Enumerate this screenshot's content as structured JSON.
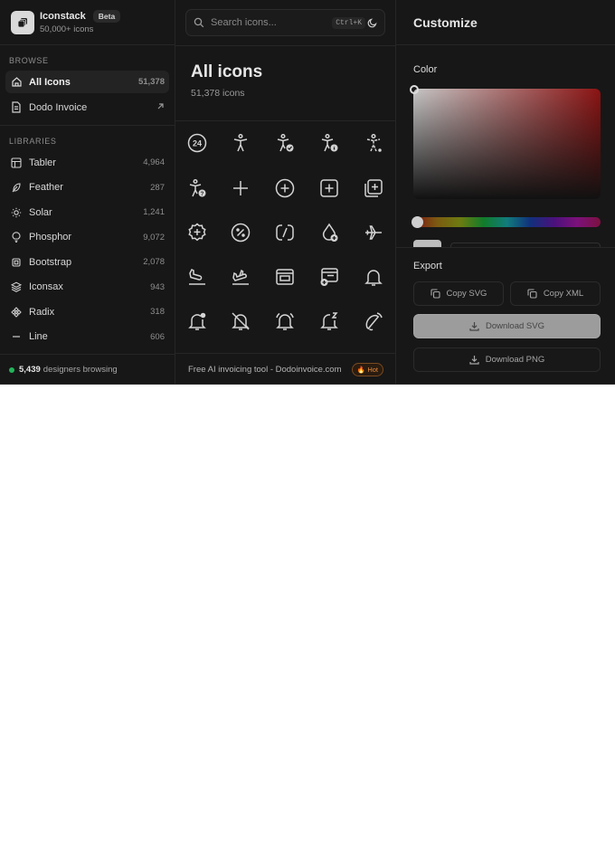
{
  "brand": {
    "name": "Iconstack",
    "badge": "Beta",
    "subtitle": "50,000+ icons"
  },
  "browse": {
    "label": "BROWSE",
    "items": [
      {
        "label": "All Icons",
        "count": "51,378",
        "icon": "home-icon",
        "active": true
      },
      {
        "label": "Dodo Invoice",
        "icon": "file-icon",
        "external": "arrow-up-right-icon"
      }
    ]
  },
  "libraries": {
    "label": "LIBRARIES",
    "items": [
      {
        "label": "Tabler",
        "count": "4,964",
        "icon": "table-icon"
      },
      {
        "label": "Feather",
        "count": "287",
        "icon": "feather-icon"
      },
      {
        "label": "Solar",
        "count": "1,241",
        "icon": "sun-icon"
      },
      {
        "label": "Phosphor",
        "count": "9,072",
        "icon": "lightbulb-icon"
      },
      {
        "label": "Bootstrap",
        "count": "2,078",
        "icon": "chip-icon"
      },
      {
        "label": "Iconsax",
        "count": "943",
        "icon": "layers-icon"
      },
      {
        "label": "Radix",
        "count": "318",
        "icon": "radix-icon"
      },
      {
        "label": "Line",
        "count": "606",
        "icon": "minus-icon"
      }
    ]
  },
  "browsing": {
    "count": "5,439",
    "text": "designers browsing"
  },
  "search": {
    "placeholder": "Search icons...",
    "shortcut": "Ctrl+K"
  },
  "main": {
    "title": "All icons",
    "count": "51,378 icons"
  },
  "icons": [
    "clock-24-icon",
    "accessible-icon",
    "accessible-check-icon",
    "accessible-info-icon",
    "accessible-off-icon",
    "accessible-question-icon",
    "plus-icon",
    "circle-plus-icon",
    "square-plus-icon",
    "squares-plus-icon",
    "badge-plus-icon",
    "badge-percent-icon",
    "ad-circle-icon",
    "droplet-plus-icon",
    "plane-icon",
    "plane-arrival-icon",
    "plane-departure-icon",
    "window-icon",
    "window-plus-icon",
    "bell-icon",
    "bell-ringing-icon",
    "bell-off-icon",
    "alarm-bell-icon",
    "bell-z-icon",
    "bell-ring-2-icon"
  ],
  "promo": {
    "text": "Free AI invoicing tool - Dodoinvoice.com",
    "badge": "Hot"
  },
  "customize": {
    "title": "Customize",
    "color_label": "Color",
    "export_label": "Export",
    "copy_svg": "Copy SVG",
    "copy_xml": "Copy XML",
    "download_svg": "Download SVG",
    "download_png": "Download PNG"
  },
  "colors": {
    "background": "#171717",
    "accent_green": "#22b45a",
    "hot": "#e58a3e"
  }
}
